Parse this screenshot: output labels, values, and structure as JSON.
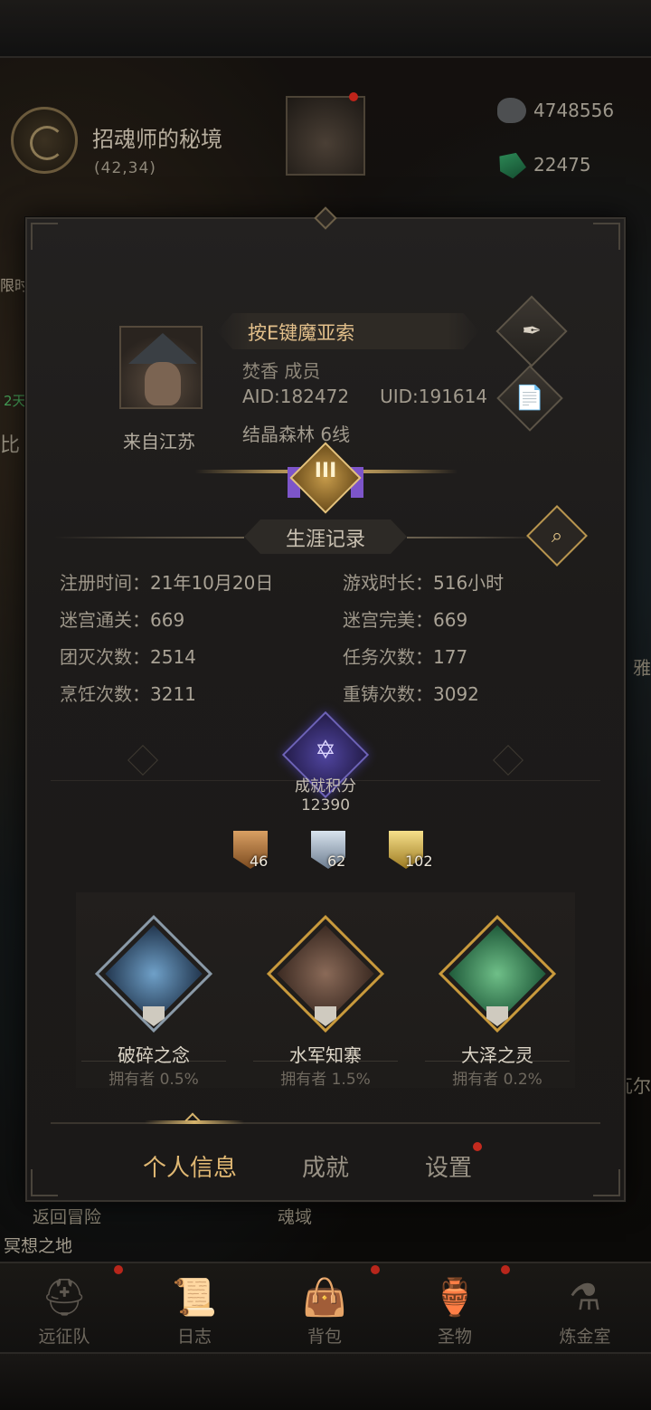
{
  "location": {
    "name": "招魂师的秘境",
    "coord": "(42,34)"
  },
  "currency": {
    "stone": "4748556",
    "gem": "22475"
  },
  "side_labels": {
    "left1": "限时",
    "left2": "2天",
    "left3": "比",
    "right1": "雅",
    "right2": "瓦尔"
  },
  "profile": {
    "name": "按E键魔亚索",
    "guild_line": "焚香 成员",
    "aid": "AID:182472",
    "uid": "UID:191614",
    "server": "结晶森林 6线",
    "origin": "来自江苏",
    "rank_numeral": "III"
  },
  "career": {
    "title": "生涯记录",
    "stats": [
      {
        "label": "注册时间：",
        "value": "21年10月20日"
      },
      {
        "label": "游戏时长：",
        "value": "516小时"
      },
      {
        "label": "迷宫通关：",
        "value": "669"
      },
      {
        "label": "迷宫完美：",
        "value": "669"
      },
      {
        "label": "团灭次数：",
        "value": "2514"
      },
      {
        "label": "任务次数：",
        "value": "177"
      },
      {
        "label": "烹饪次数：",
        "value": "3211"
      },
      {
        "label": "重铸次数：",
        "value": "3092"
      }
    ]
  },
  "achievement": {
    "label": "成就积分",
    "score": "12390",
    "medals": [
      {
        "tier": "bronze",
        "count": "46"
      },
      {
        "tier": "silver",
        "count": "62"
      },
      {
        "tier": "gold",
        "count": "102"
      }
    ]
  },
  "trophies": [
    {
      "name": "破碎之念",
      "owners": "拥有者 0.5%"
    },
    {
      "name": "水军知寨",
      "owners": "拥有者 1.5%"
    },
    {
      "name": "大泽之灵",
      "owners": "拥有者 0.2%"
    }
  ],
  "tabs": {
    "info": "个人信息",
    "achievements": "成就",
    "settings": "设置"
  },
  "scene": {
    "return": "返回冒险",
    "soul_realm": "魂域",
    "meditate": "冥想之地"
  },
  "bottom_nav": [
    {
      "label": "远征队",
      "icon": "helmet-icon"
    },
    {
      "label": "日志",
      "icon": "scroll-icon"
    },
    {
      "label": "背包",
      "icon": "bag-icon"
    },
    {
      "label": "圣物",
      "icon": "relic-icon"
    },
    {
      "label": "炼金室",
      "icon": "alchemy-icon"
    }
  ],
  "colors": {
    "accent_gold": "#e0b873",
    "notification_red": "#c42a1e",
    "achievement_purple": "#5045a0"
  }
}
